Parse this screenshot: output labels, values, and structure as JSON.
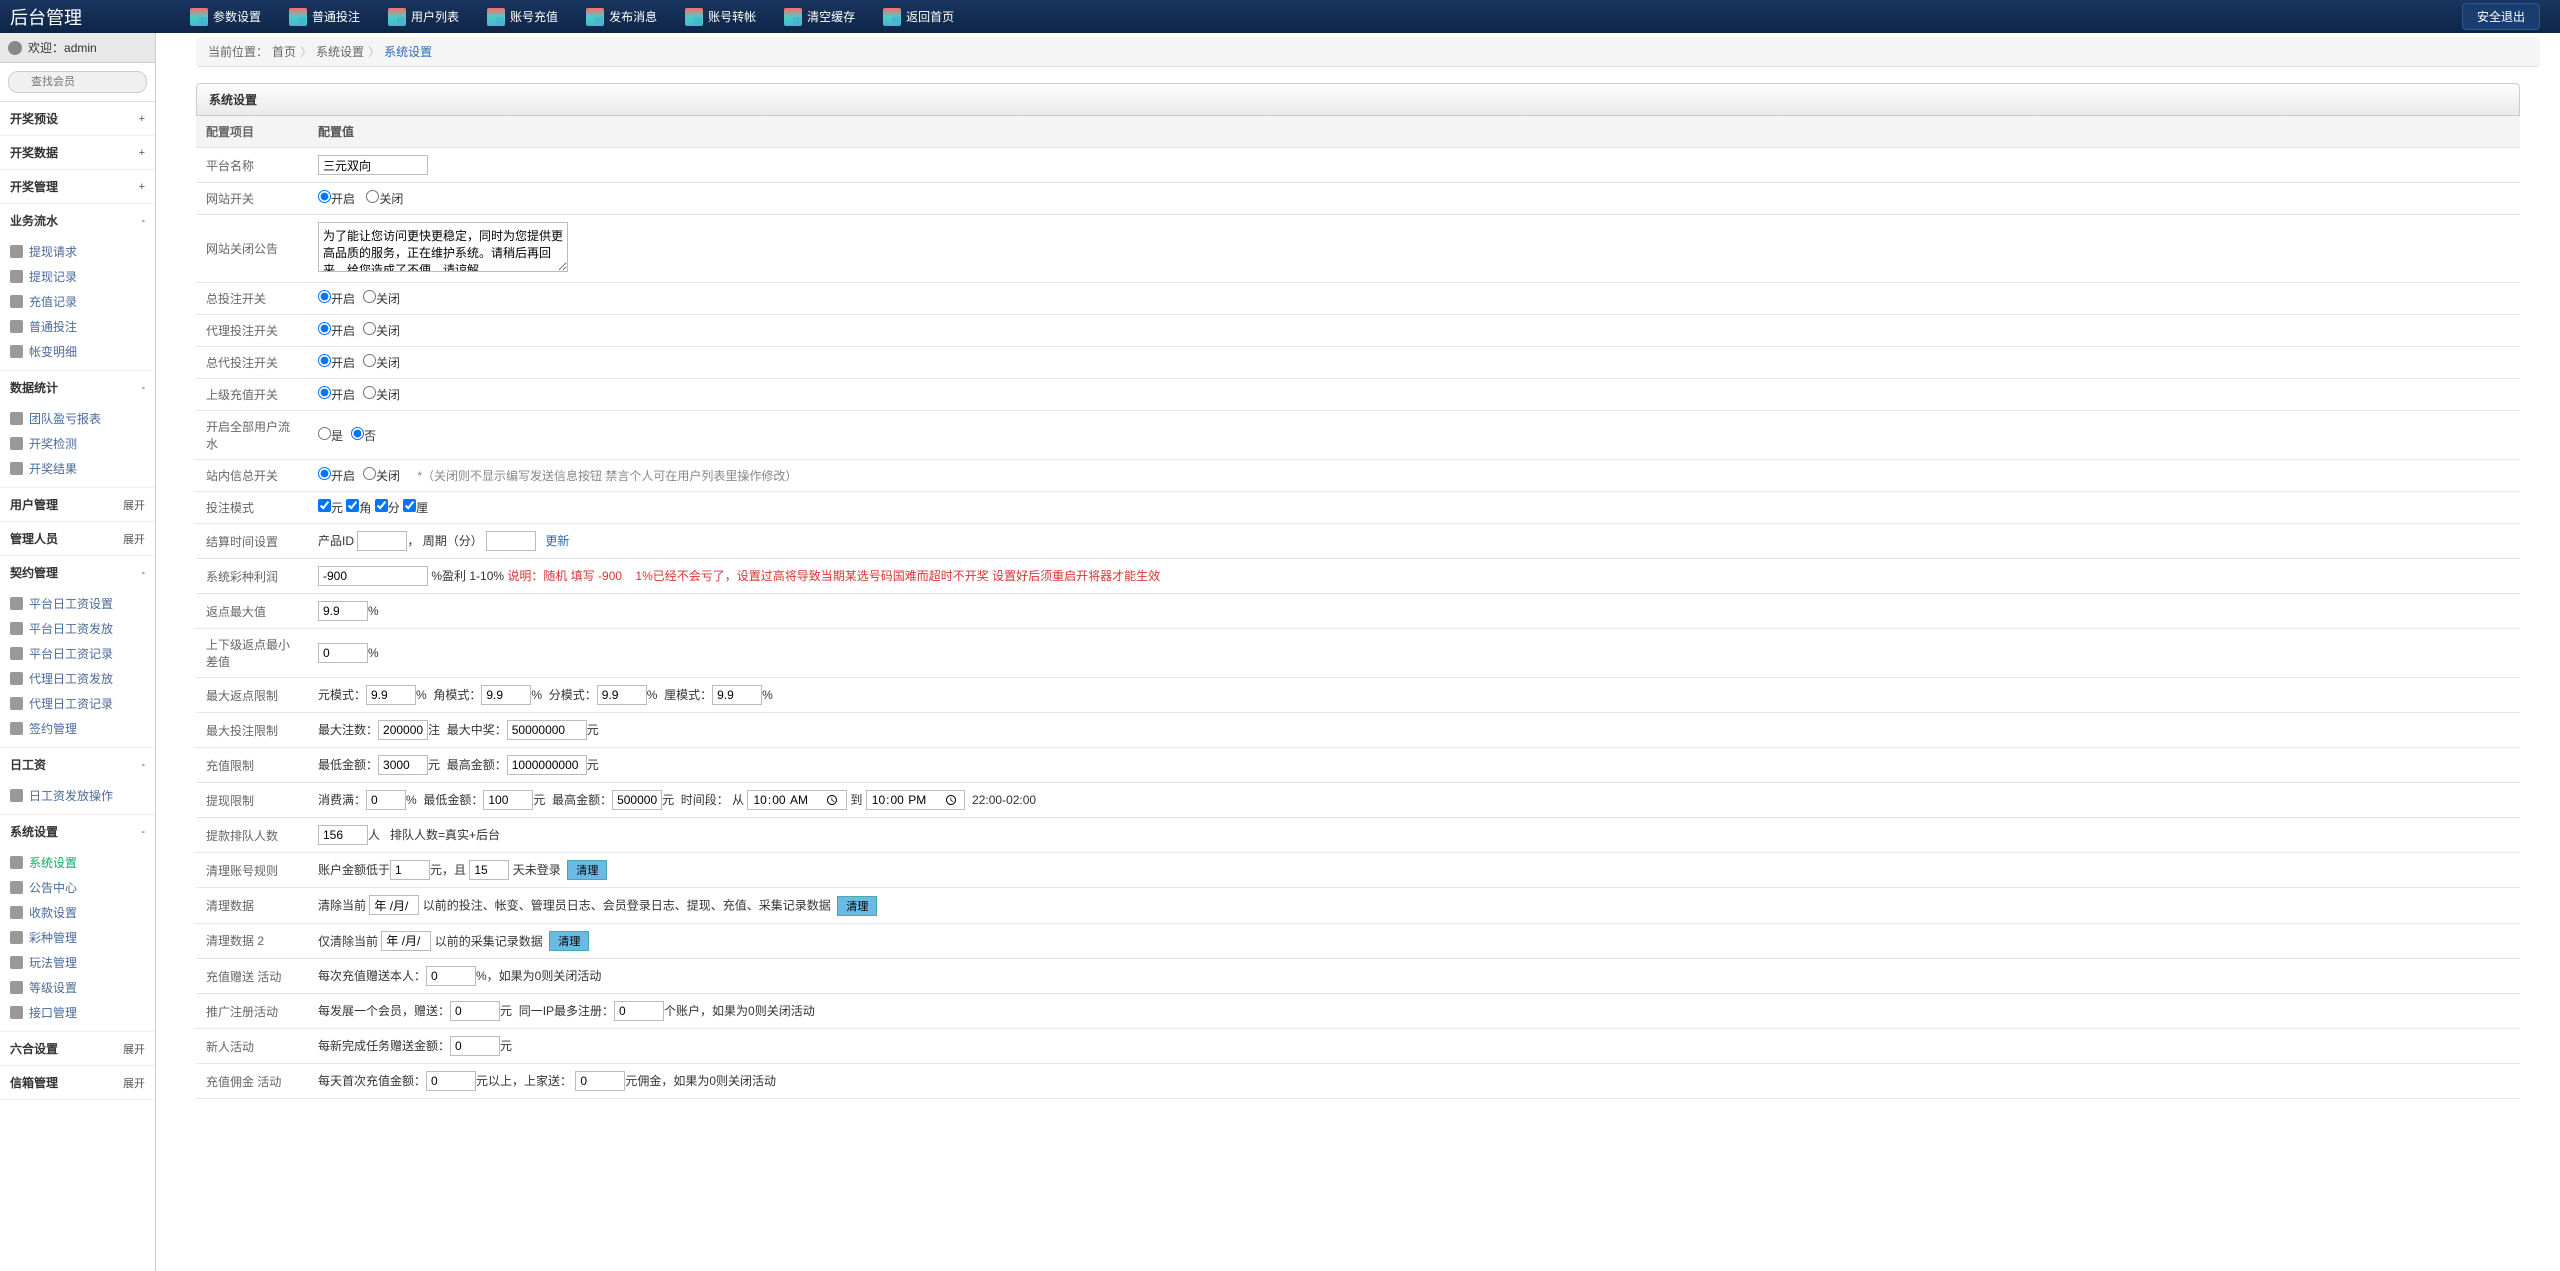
{
  "app_title": "后台管理",
  "welcome_prefix": "欢迎：",
  "welcome_user": "admin",
  "search_placeholder": "查找会员",
  "logout": "安全退出",
  "topnav": [
    {
      "label": "参数设置"
    },
    {
      "label": "普通投注"
    },
    {
      "label": "用户列表"
    },
    {
      "label": "账号充值"
    },
    {
      "label": "发布消息"
    },
    {
      "label": "账号转帐"
    },
    {
      "label": "清空缓存"
    },
    {
      "label": "返回首页"
    }
  ],
  "menu": [
    {
      "title": "开奖预设",
      "exp": "+",
      "items": []
    },
    {
      "title": "开奖数据",
      "exp": "+",
      "items": []
    },
    {
      "title": "开奖管理",
      "exp": "+",
      "items": []
    },
    {
      "title": "业务流水",
      "exp": "-",
      "items": [
        "提现请求",
        "提现记录",
        "充值记录",
        "普通投注",
        "帐变明细"
      ]
    },
    {
      "title": "数据统计",
      "exp": "-",
      "items": [
        "团队盈亏报表",
        "开奖检测",
        "开奖结果"
      ]
    },
    {
      "title": "用户管理",
      "exp": "展开",
      "items": []
    },
    {
      "title": "管理人员",
      "exp": "展开",
      "items": []
    },
    {
      "title": "契约管理",
      "exp": "-",
      "items": [
        "平台日工资设置",
        "平台日工资发放",
        "平台日工资记录",
        "代理日工资发放",
        "代理日工资记录",
        "签约管理"
      ]
    },
    {
      "title": "日工资",
      "exp": "-",
      "items": [
        "日工资发放操作"
      ]
    },
    {
      "title": "系统设置",
      "exp": "-",
      "items": [
        "系统设置",
        "公告中心",
        "收款设置",
        "彩种管理",
        "玩法管理",
        "等级设置",
        "接口管理"
      ],
      "activeIndex": 0
    },
    {
      "title": "六合设置",
      "exp": "展开",
      "items": []
    },
    {
      "title": "信箱管理",
      "exp": "展开",
      "items": []
    }
  ],
  "breadcrumb": {
    "prefix": "当前位置：",
    "home": "首页",
    "mid": "系统设置",
    "cur": "系统设置"
  },
  "panel_title": "系统设置",
  "cols": {
    "c1": "配置项目",
    "c2": "配置值"
  },
  "labels": {
    "platform": "平台名称",
    "site_switch": "网站开关",
    "close_notice": "网站关闭公告",
    "total_bet": "总投注开关",
    "agent_bet": "代理投注开关",
    "total_agent_bet": "总代投注开关",
    "upper_recharge": "上级充值开关",
    "open_all_flow": "开启全部用户流水",
    "site_msg": "站内信总开关",
    "bet_mode": "投注模式",
    "settle_time": "结算时间设置",
    "lottery_interest": "系统彩种利润",
    "rebate_max": "返点最大值",
    "rebate_diff": "上下级返点最小差值",
    "max_rebate_limit": "最大返点限制",
    "max_bet_limit": "最大投注限制",
    "recharge_limit": "充值限制",
    "withdraw_limit": "提现限制",
    "withdraw_queue": "提款排队人数",
    "clear_account": "清理账号规则",
    "clear_data": "清理数据",
    "clear_data2": "清理数据 2",
    "recharge_gift": "充值赠送 活动",
    "promote_reg": "推广注册活动",
    "newcomer": "新人活动",
    "recharge_commission": "充值佣金 活动"
  },
  "opts": {
    "open": "开启",
    "close": "关闭",
    "yes": "是",
    "no": "否",
    "yuan": "元",
    "jiao": "角",
    "fen": "分",
    "li": "厘"
  },
  "values": {
    "platform_name": "三元双向",
    "close_notice_text": "为了能让您访问更快更稳定，同时为您提供更高品质的服务，正在维护系统。请稍后再回来。给您造成了不便，请谅解。",
    "site_msg_hint": "*（关闭则不显示编写发送信息按钮 禁言个人可在用户列表里操作修改）",
    "settle_product": "产品ID",
    "settle_period": "周期（分）",
    "settle_more": "更新",
    "interest": "-900",
    "interest_hint1": "%盈利 1-10% ",
    "interest_red": "说明：随机 填写 -900",
    "interest_gap": "1%已经不会亏了，设置过高将导致当期某选号码国难而超时不开奖 设置好后须重启开将器才能生效",
    "rebate_max": "9.9",
    "rebate_diff": "0",
    "limit_yuan_lbl": "元模式：",
    "limit_jiao_lbl": "角模式：",
    "limit_fen_lbl": "分模式：",
    "limit_li_lbl": "厘模式：",
    "limit_yuan": "9.9",
    "limit_jiao": "9.9",
    "limit_fen": "9.9",
    "limit_li": "9.9",
    "maxbet_count_lbl": "最大注数：",
    "maxbet_count": "200000",
    "maxbet_win_lbl": "最大中奖：",
    "maxbet_win": "50000000",
    "recharge_min_lbl": "最低金额：",
    "recharge_min": "3000",
    "recharge_max_lbl": "最高金额：",
    "recharge_max": "1000000000",
    "withdraw_consume_lbl": "消费满：",
    "withdraw_consume": "0",
    "withdraw_min_lbl": "最低金额：",
    "withdraw_min": "100",
    "withdraw_max_lbl": "最高金额：",
    "withdraw_max": "5000000",
    "withdraw_time_lbl": "时间段：",
    "withdraw_from": "从",
    "withdraw_t1": "10:00",
    "withdraw_to": "到",
    "withdraw_t2": "22:00",
    "withdraw_span": "22:00-02:00",
    "queue": "156",
    "queue_hint": "排队人数=真实+后台",
    "clear_bal_lbl": "账户金额低于",
    "clear_bal": "1",
    "clear_and": "元，且",
    "clear_days": "15",
    "clear_days_lbl": "天未登录",
    "clear_btn": "清理",
    "clear_before": "清除当前",
    "clear_before_hint": "以前的投注、帐变、管理员日志、会员登录日志、提现、充值、采集记录数据",
    "clear2_before": "仅清除当前",
    "clear2_hint": "以前的采集记录数据",
    "gift_lbl": "每次充值赠送本人：",
    "gift": "0",
    "gift_hint": "%，如果为0则关闭活动",
    "promote_lbl": "每发展一个会员，赠送：",
    "promote": "0",
    "promote_ip_lbl": "同一IP最多注册：",
    "promote_ip": "0",
    "promote_hint": "个账户，如果为0则关闭活动",
    "newc_lbl": "每新完成任务赠送金额：",
    "newc": "0",
    "comm_lbl": "每天首次充值金额：",
    "comm_a": "0",
    "comm_mid": "元以上，上家送：",
    "comm_b": "0",
    "comm_hint": "元佣金，如果为0则关闭活动",
    "zhu": "注",
    "ren": "人",
    "yuan_u": "元",
    "pct": "%",
    "date": "年 /月/"
  }
}
